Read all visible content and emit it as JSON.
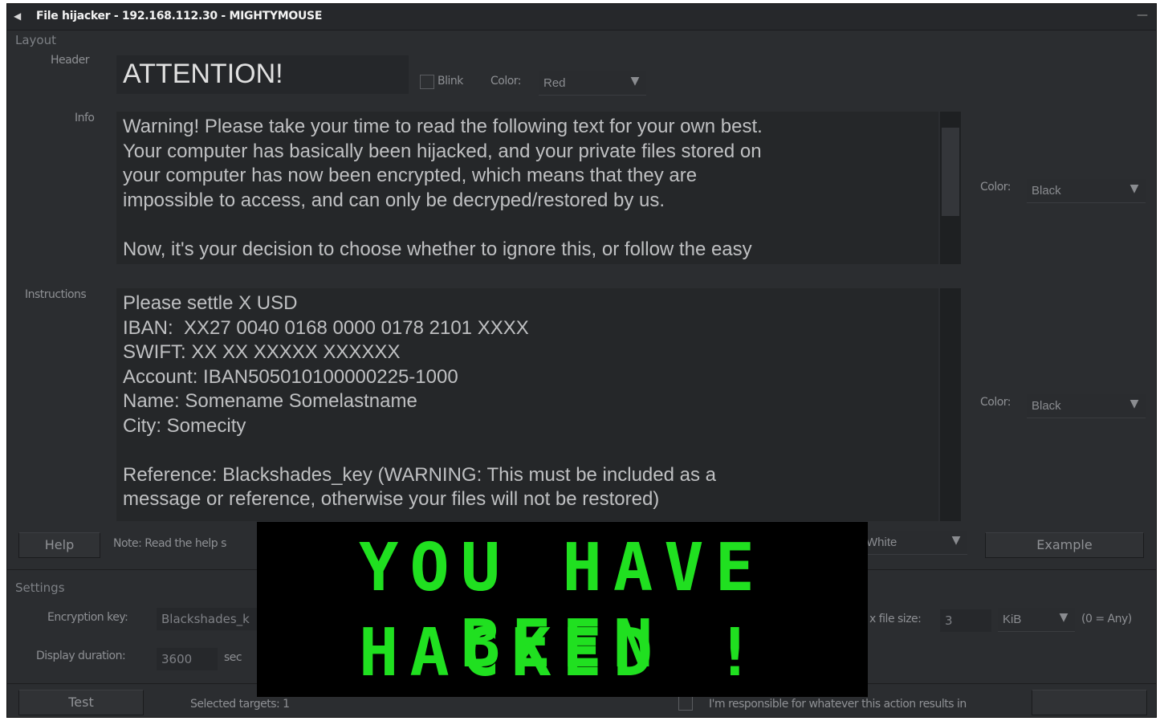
{
  "window": {
    "title": "File hijacker - 192.168.112.30 - MIGHTYMOUSE",
    "minimize": "—"
  },
  "layout_section": "Layout",
  "header": {
    "label": "Header",
    "value": "ATTENTION!",
    "blink_label": "Blink",
    "color_label": "Color:",
    "color_value": "Red"
  },
  "info": {
    "label": "Info",
    "text": "Warning! Please take your time to read the following text for your own best.\nYour computer has basically been hijacked, and your private files stored on\nyour computer has now been encrypted, which means that they are\nimpossible to access, and can only be decryped/restored by us.\n\nNow, it's your decision to choose whether to ignore this, or follow the easy",
    "color_label": "Color:",
    "color_value": "Black"
  },
  "instructions": {
    "label": "Instructions",
    "text": "Please settle X USD\nIBAN:  XX27 0040 0168 0000 0178 2101 XXXX\nSWIFT: XX XX XXXXX XXXXXX\nAccount: IBAN505010100000225-1000\nName: Somename Somelastname\nCity: Somecity\n\nReference: Blackshades_key (WARNING: This must be included as a\nmessage or reference, otherwise your files will not be restored)",
    "color_label": "Color:",
    "color_value": "Black"
  },
  "help_row": {
    "help_button": "Help",
    "note": "Note: Read the help s",
    "bg_value": "White",
    "example_button": "Example"
  },
  "settings_section": "Settings",
  "settings": {
    "encryption_key_label": "Encryption key:",
    "encryption_key_value": "Blackshades_k",
    "display_duration_label": "Display duration:",
    "display_duration_value": "3600",
    "sec_label": "sec",
    "max_file_size_label": "x file size:",
    "max_file_size_value": "3",
    "unit_value": "KiB",
    "any_hint": "(0 = Any)"
  },
  "footer": {
    "test_button": "Test",
    "selected_targets": "Selected targets: 1",
    "responsibility": "I'm responsible for whatever this action results in"
  },
  "overlay": {
    "line1": "YOU HAVE BEEN",
    "line2": "HACKED !",
    "text_color": "#20e020"
  }
}
